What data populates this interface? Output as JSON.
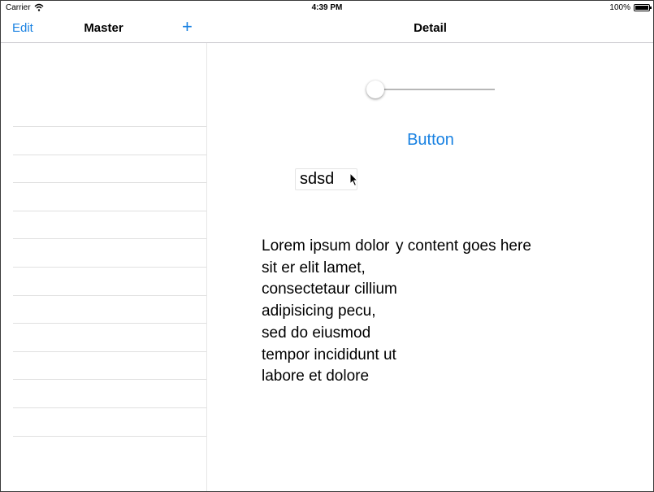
{
  "status_bar": {
    "carrier": "Carrier",
    "time": "4:39 PM",
    "battery": "100%"
  },
  "master": {
    "edit_label": "Edit",
    "title": "Master",
    "add_symbol": "+",
    "row_count": 12
  },
  "detail": {
    "title": "Detail",
    "slider_value": 0.0,
    "button_label": "Button",
    "field_value": "sdsd",
    "lorem_text": "Lorem ipsum dolor sit er elit lamet, consectetaur cillium adipisicing pecu, sed do eiusmod tempor incididunt ut labore et dolore",
    "secondary_text": "y content goes here"
  },
  "colors": {
    "accent": "#1a82e2",
    "separator": "#c8c7cc",
    "row_separator": "#e0e0e0"
  }
}
